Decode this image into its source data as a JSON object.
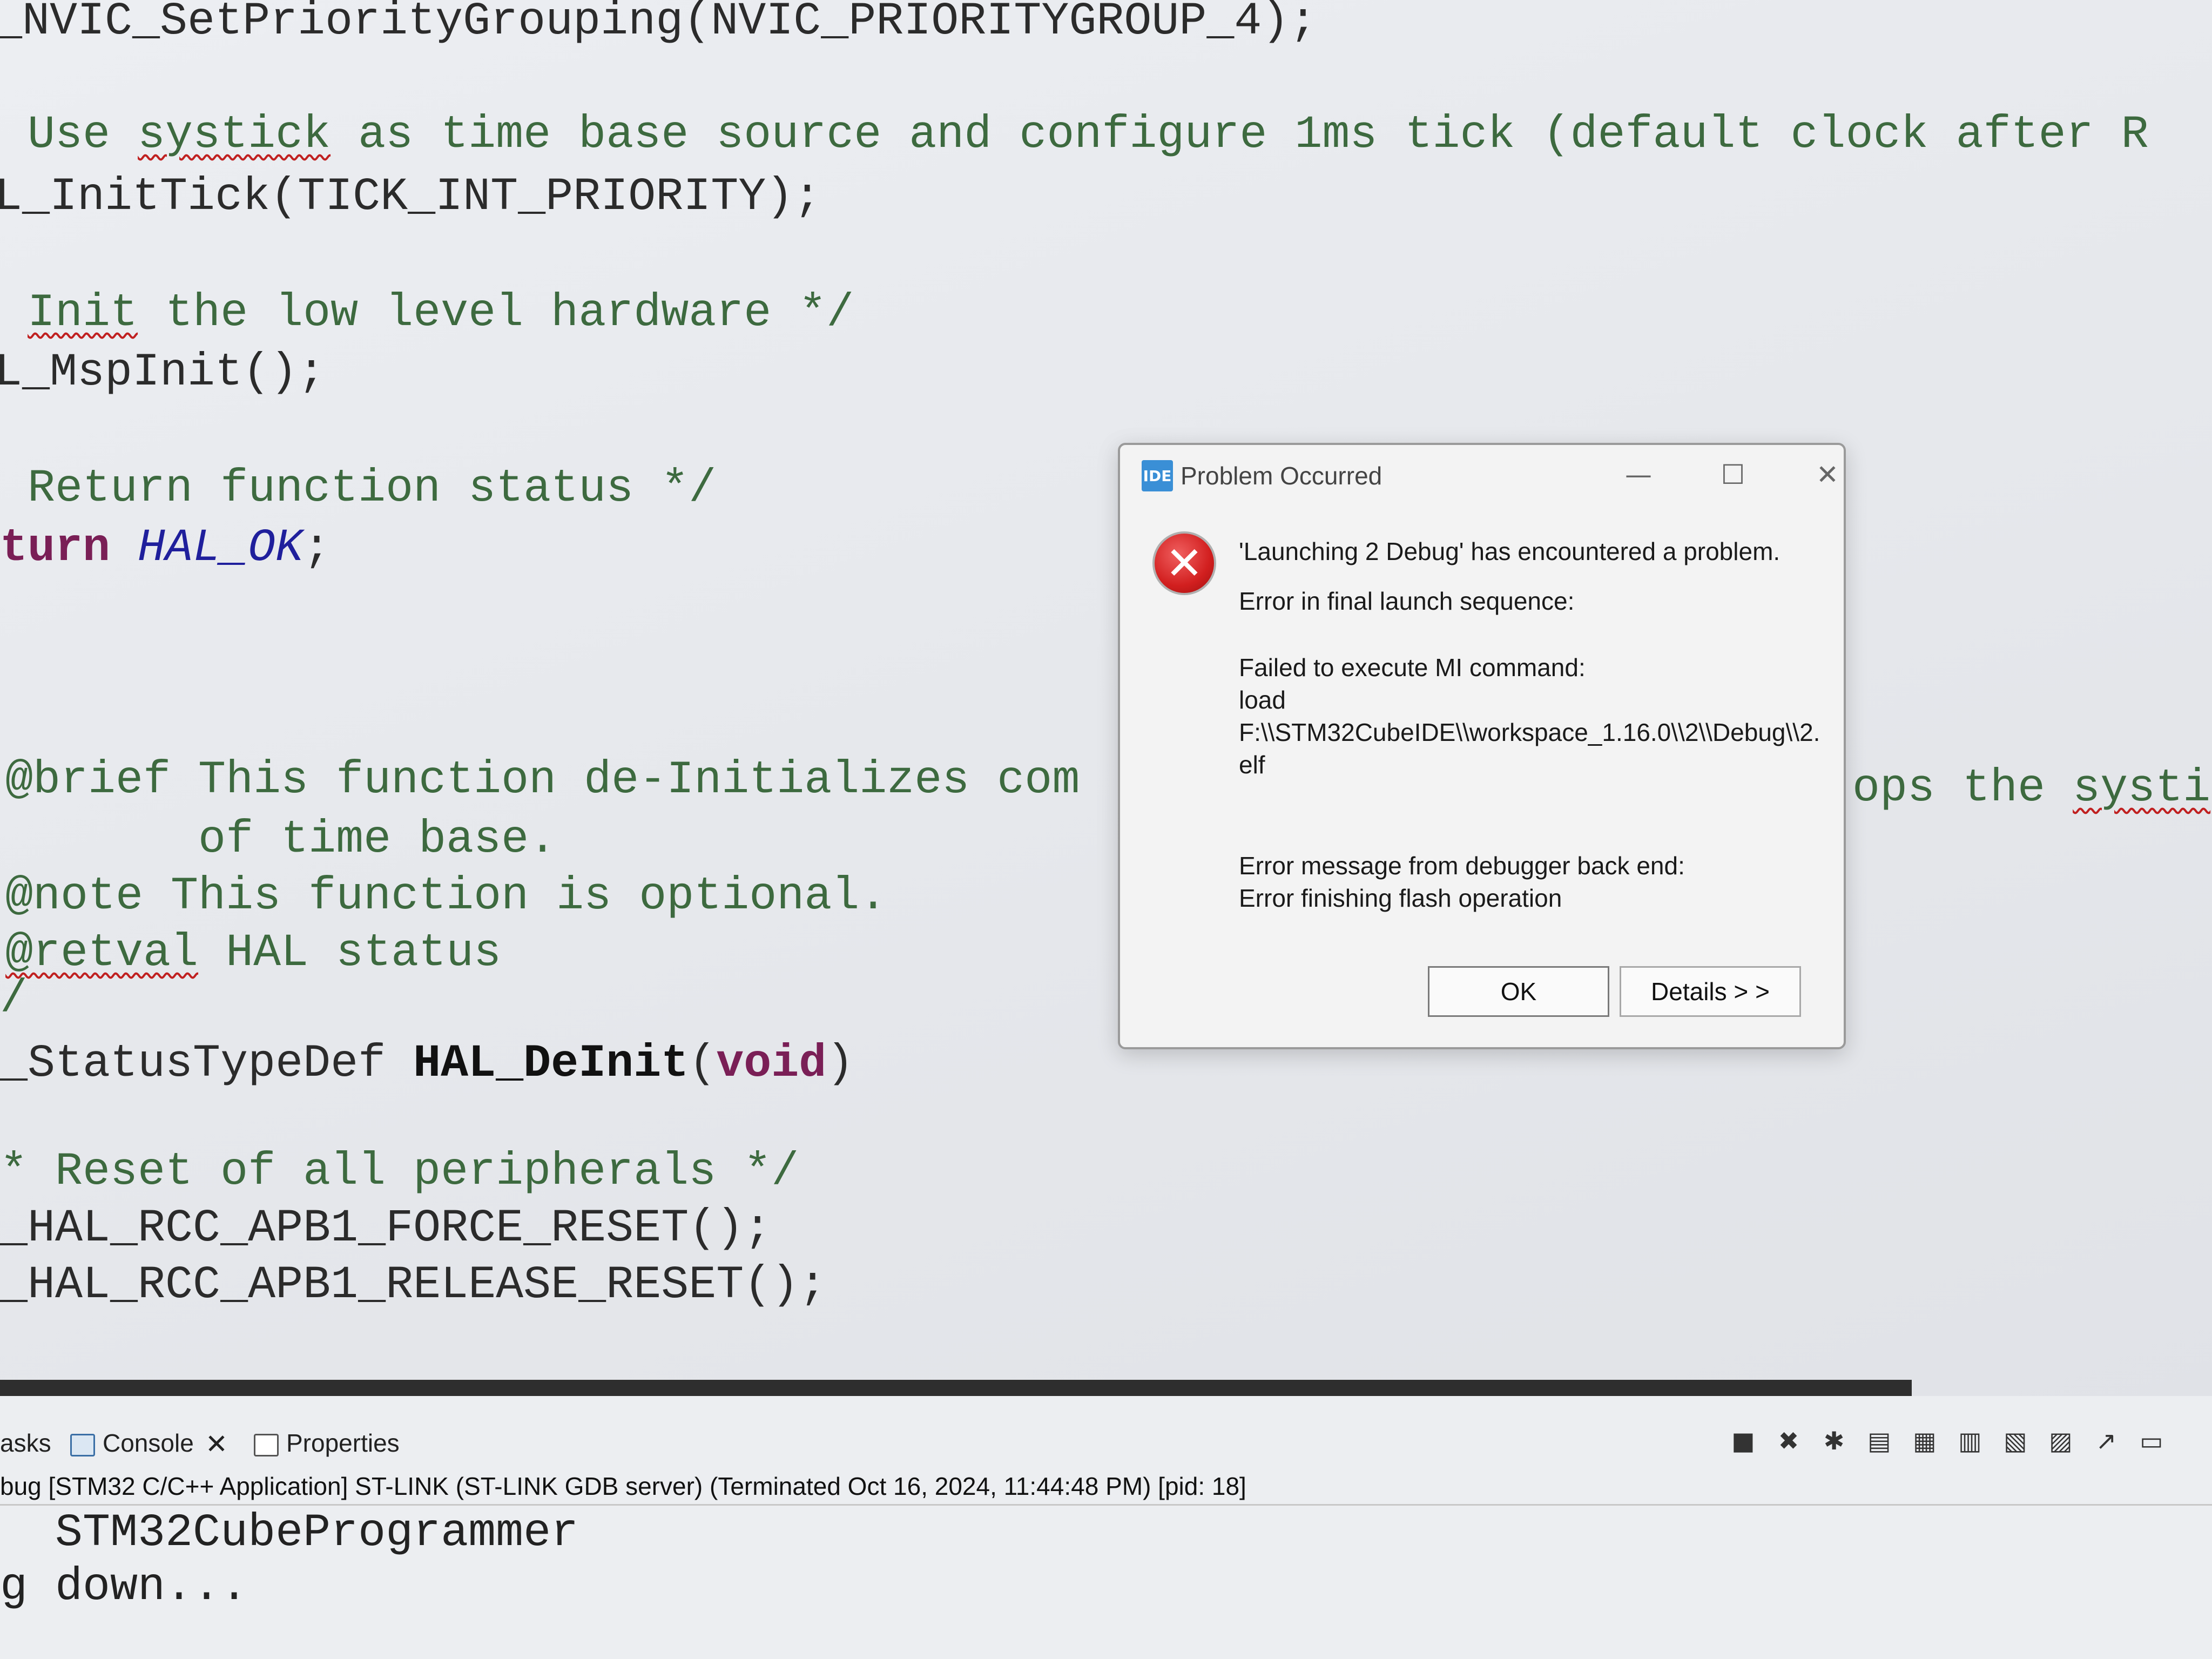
{
  "editor": {
    "lines": [
      {
        "id": "l1",
        "segments": [
          {
            "t": "_NVIC_SetPriorityGrouping(NVIC_PRIORITYGROUP_4);",
            "c": ""
          }
        ]
      },
      {
        "id": "l2",
        "segments": [
          {
            "t": " Use ",
            "c": "cmt"
          },
          {
            "t": "systick",
            "c": "cmt squiggle"
          },
          {
            "t": " as time base source and configure 1ms tick (default clock after R",
            "c": "cmt"
          }
        ]
      },
      {
        "id": "l3",
        "segments": [
          {
            "t": "L_InitTick(TICK_INT_PRIORITY);",
            "c": ""
          }
        ]
      },
      {
        "id": "l4",
        "segments": [
          {
            "t": " ",
            "c": "cmt"
          },
          {
            "t": "Init",
            "c": "cmt squiggle"
          },
          {
            "t": " the low level hardware */",
            "c": "cmt"
          }
        ]
      },
      {
        "id": "l5",
        "segments": [
          {
            "t": "L_MspInit();",
            "c": ""
          }
        ]
      },
      {
        "id": "l6",
        "segments": [
          {
            "t": " Return function status */",
            "c": "cmt"
          }
        ]
      },
      {
        "id": "l7",
        "segments": [
          {
            "t": "turn ",
            "c": "kw"
          },
          {
            "t": "HAL_OK",
            "c": "ital"
          },
          {
            "t": ";",
            "c": ""
          }
        ]
      },
      {
        "id": "l8",
        "segments": [
          {
            "t": "@brief This function de-Initializes com",
            "c": "cmt"
          }
        ]
      },
      {
        "id": "l8b",
        "segments": [
          {
            "t": "ops the ",
            "c": "cmt"
          },
          {
            "t": "systi",
            "c": "cmt squiggle"
          }
        ]
      },
      {
        "id": "l9",
        "segments": [
          {
            "t": "       of time base.",
            "c": "cmt"
          }
        ]
      },
      {
        "id": "l10",
        "segments": [
          {
            "t": "@note This function is optional.",
            "c": "cmt"
          }
        ]
      },
      {
        "id": "l11",
        "segments": [
          {
            "t": "@retval",
            "c": "cmt squiggle"
          },
          {
            "t": " HAL status",
            "c": "cmt"
          }
        ]
      },
      {
        "id": "l12",
        "segments": [
          {
            "t": "/",
            "c": "cmt"
          }
        ]
      },
      {
        "id": "l13",
        "segments": [
          {
            "t": "_StatusTypeDef ",
            "c": ""
          },
          {
            "t": "HAL_DeInit",
            "c": "bold"
          },
          {
            "t": "(",
            "c": ""
          },
          {
            "t": "void",
            "c": "kw"
          },
          {
            "t": ")",
            "c": ""
          }
        ]
      },
      {
        "id": "l14",
        "segments": [
          {
            "t": "* Reset of all peripherals */",
            "c": "cmt"
          }
        ]
      },
      {
        "id": "l15",
        "segments": [
          {
            "t": "_HAL_RCC_APB1_FORCE_RESET();",
            "c": ""
          }
        ]
      },
      {
        "id": "l16",
        "segments": [
          {
            "t": "_HAL_RCC_APB1_RELEASE_RESET();",
            "c": ""
          }
        ]
      }
    ]
  },
  "dialog": {
    "title": "Problem Occurred",
    "app_icon_label": "IDE",
    "message_title": "'Launching 2 Debug' has encountered a problem.",
    "message_seq": "Error in final launch sequence:",
    "message_mi": "Failed to execute MI command:",
    "message_load": "load",
    "message_path": "F:\\\\STM32CubeIDE\\\\workspace_1.16.0\\\\2\\\\Debug\\\\2.",
    "message_elf": "elf",
    "message_backend": "Error message from debugger back end:",
    "message_flash": "Error finishing flash operation",
    "ok_label": "OK",
    "details_label": "Details > >",
    "minimize_glyph": "—",
    "maximize_glyph": "☐",
    "close_glyph": "✕",
    "error_glyph": "✕"
  },
  "panel": {
    "tabs": {
      "tasks": "asks",
      "console": "Console",
      "console_close": "✕",
      "properties": "Properties"
    },
    "status": "bug [STM32 C/C++ Application] ST-LINK (ST-LINK GDB server) (Terminated Oct 16, 2024, 11:44:48 PM) [pid: 18]",
    "console_lines": [
      "  STM32CubeProgrammer",
      "g down..."
    ],
    "toolbar_icons": [
      "stop-icon",
      "remove-launch-icon",
      "remove-all-icon",
      "scroll-lock-icon",
      "word-wrap-icon",
      "pin-icon",
      "display-console-icon",
      "open-console-icon",
      "new-console-icon",
      "view-menu-icon"
    ],
    "toolbar_glyphs": [
      "■",
      "✖",
      "✱",
      "▤",
      "▦",
      "▥",
      "▧",
      "▨",
      "↗",
      "▭"
    ]
  }
}
